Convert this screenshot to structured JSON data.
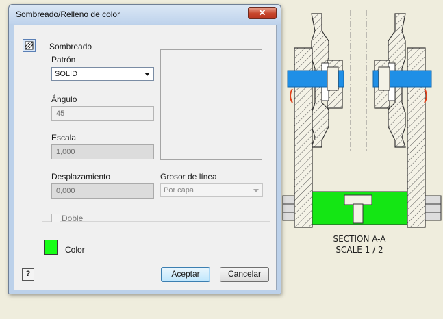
{
  "drawing": {
    "section_title": "SECTION A-A",
    "section_scale": "SCALE 1 / 2",
    "fill_color": "#00ff00",
    "highlight_color": "#1e90ff"
  },
  "dialog": {
    "title": "Sombreado/Relleno de color",
    "close_glyph": "✕",
    "group_label": "Sombreado",
    "pattern": {
      "label": "Patrón",
      "value": "SOLID"
    },
    "angle": {
      "label": "Ángulo",
      "value": "45"
    },
    "scale": {
      "label": "Escala",
      "value": "1,000"
    },
    "offset": {
      "label": "Desplazamiento",
      "value": "0,000"
    },
    "line_weight": {
      "label": "Grosor de línea",
      "value": "Por capa"
    },
    "double": {
      "label": "Doble",
      "checked": false
    },
    "color": {
      "label": "Color",
      "swatch": "#17ff17"
    },
    "help_glyph": "?",
    "ok_label": "Aceptar",
    "cancel_label": "Cancelar"
  }
}
